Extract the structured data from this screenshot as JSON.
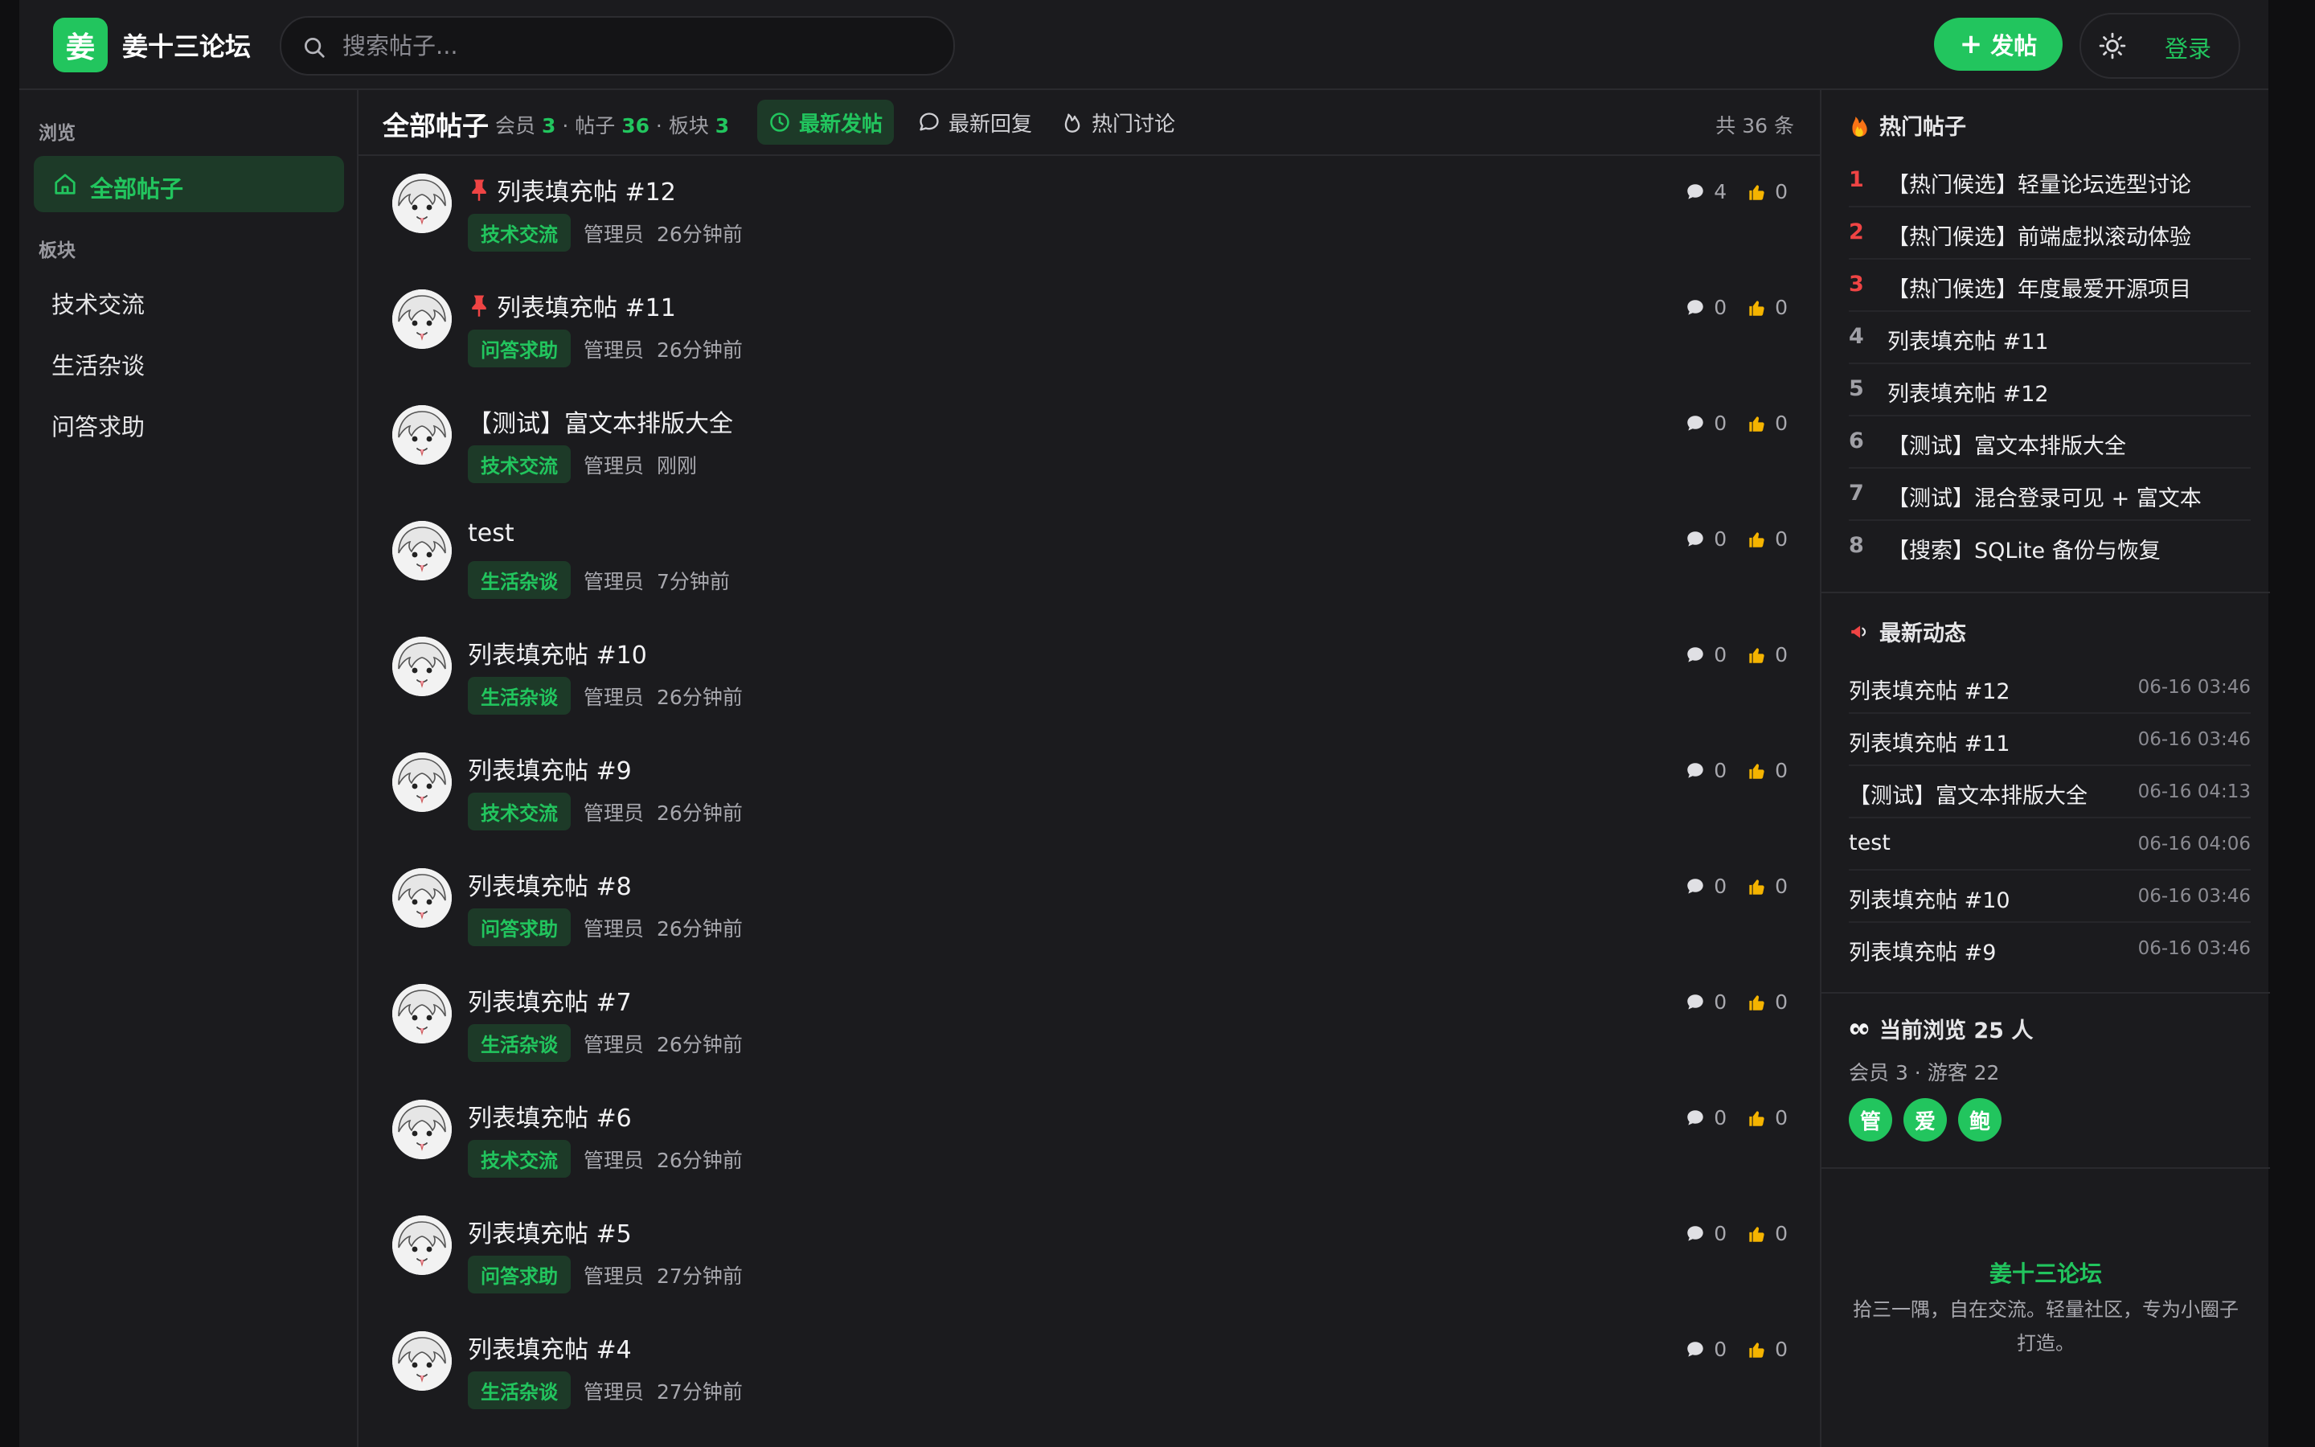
{
  "brand": {
    "logo_char": "姜",
    "name": "姜十三论坛",
    "accent": "#22c55e"
  },
  "header": {
    "search_placeholder": "搜索帖子...",
    "post_button": "发帖",
    "login": "登录"
  },
  "sidebar": {
    "browse_label": "浏览",
    "all_posts": "全部帖子",
    "boards_label": "板块",
    "boards": [
      "技术交流",
      "生活杂谈",
      "问答求助"
    ]
  },
  "main": {
    "title": "全部帖子",
    "stats": {
      "members_label": "会员",
      "members": "3",
      "posts_label": "帖子",
      "posts": "36",
      "boards_label": "板块",
      "boards": "3"
    },
    "tabs": [
      "最新发帖",
      "最新回复",
      "热门讨论"
    ],
    "total": "共 36 条",
    "posts": [
      {
        "title": "列表填充帖 #12",
        "pinned": true,
        "tag": "技术交流",
        "author": "管理员",
        "time": "26分钟前",
        "comments": "4",
        "likes": "0"
      },
      {
        "title": "列表填充帖 #11",
        "pinned": true,
        "tag": "问答求助",
        "author": "管理员",
        "time": "26分钟前",
        "comments": "0",
        "likes": "0"
      },
      {
        "title": "【测试】富文本排版大全",
        "pinned": false,
        "tag": "技术交流",
        "author": "管理员",
        "time": "刚刚",
        "comments": "0",
        "likes": "0"
      },
      {
        "title": "test",
        "pinned": false,
        "tag": "生活杂谈",
        "author": "管理员",
        "time": "7分钟前",
        "comments": "0",
        "likes": "0"
      },
      {
        "title": "列表填充帖 #10",
        "pinned": false,
        "tag": "生活杂谈",
        "author": "管理员",
        "time": "26分钟前",
        "comments": "0",
        "likes": "0"
      },
      {
        "title": "列表填充帖 #9",
        "pinned": false,
        "tag": "技术交流",
        "author": "管理员",
        "time": "26分钟前",
        "comments": "0",
        "likes": "0"
      },
      {
        "title": "列表填充帖 #8",
        "pinned": false,
        "tag": "问答求助",
        "author": "管理员",
        "time": "26分钟前",
        "comments": "0",
        "likes": "0"
      },
      {
        "title": "列表填充帖 #7",
        "pinned": false,
        "tag": "生活杂谈",
        "author": "管理员",
        "time": "26分钟前",
        "comments": "0",
        "likes": "0"
      },
      {
        "title": "列表填充帖 #6",
        "pinned": false,
        "tag": "技术交流",
        "author": "管理员",
        "time": "26分钟前",
        "comments": "0",
        "likes": "0"
      },
      {
        "title": "列表填充帖 #5",
        "pinned": false,
        "tag": "问答求助",
        "author": "管理员",
        "time": "27分钟前",
        "comments": "0",
        "likes": "0"
      },
      {
        "title": "列表填充帖 #4",
        "pinned": false,
        "tag": "生活杂谈",
        "author": "管理员",
        "time": "27分钟前",
        "comments": "0",
        "likes": "0"
      }
    ]
  },
  "right": {
    "hot_title": "热门帖子",
    "hot": [
      "【热门候选】轻量论坛选型讨论",
      "【热门候选】前端虚拟滚动体验",
      "【热门候选】年度最爱开源项目",
      "列表填充帖 #11",
      "列表填充帖 #12",
      "【测试】富文本排版大全",
      "【测试】混合登录可见 + 富文本",
      "【搜索】SQLite 备份与恢复"
    ],
    "feed_title": "最新动态",
    "feed": [
      {
        "title": "列表填充帖 #12",
        "time": "06-16 03:46"
      },
      {
        "title": "列表填充帖 #11",
        "time": "06-16 03:46"
      },
      {
        "title": "【测试】富文本排版大全",
        "time": "06-16 04:13"
      },
      {
        "title": "test",
        "time": "06-16 04:06"
      },
      {
        "title": "列表填充帖 #10",
        "time": "06-16 03:46"
      },
      {
        "title": "列表填充帖 #9",
        "time": "06-16 03:46"
      }
    ],
    "online_title": "当前浏览 25 人",
    "online_sub": "会员 3 · 游客 22",
    "online_avatars": [
      "管",
      "爱",
      "鲍"
    ],
    "footer_brand": "姜十三论坛",
    "footer_desc": "拾三一隅，自在交流。轻量社区，专为小圈子打造。"
  }
}
